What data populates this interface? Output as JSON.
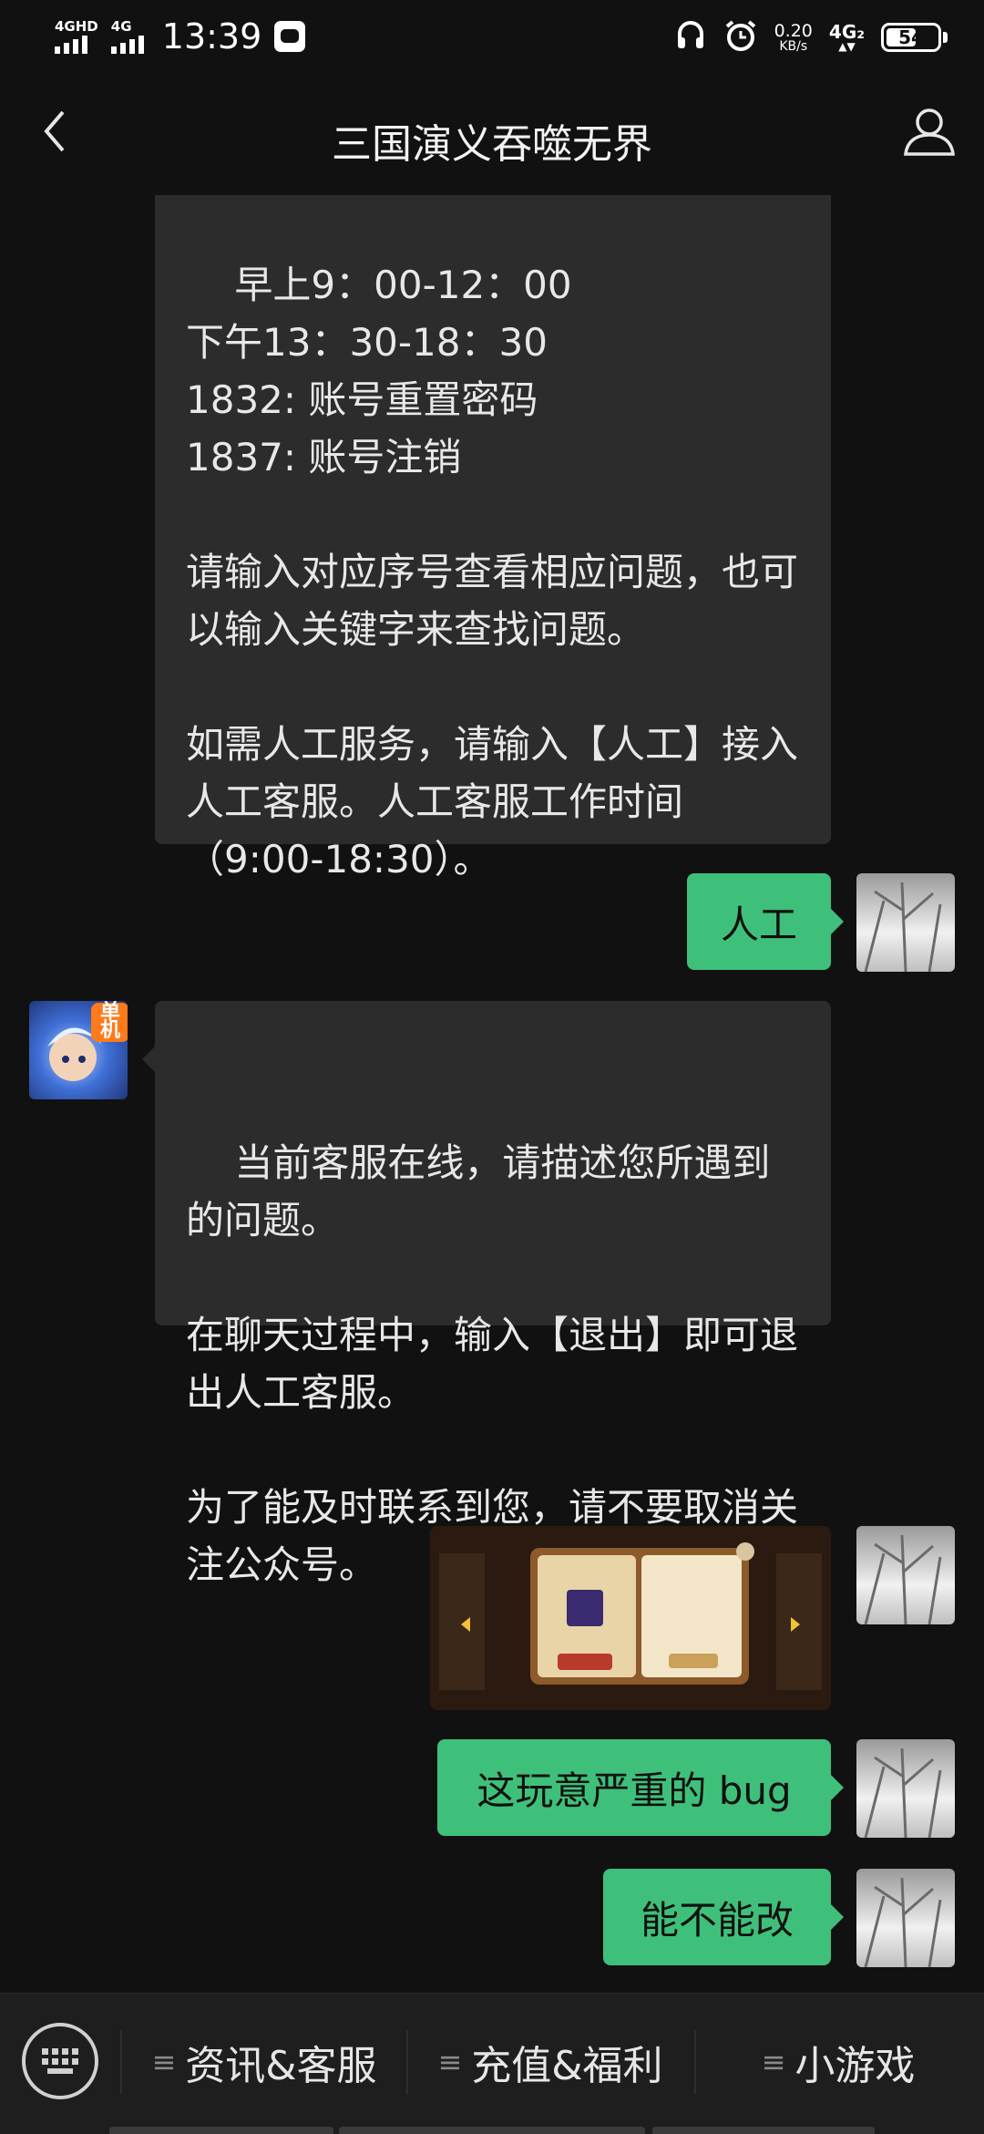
{
  "status_bar": {
    "network1": "4GHD",
    "network2": "4G",
    "time": "13:39",
    "speed_value": "0.20",
    "speed_unit": "KB/s",
    "network3": "4G₂",
    "battery": "54"
  },
  "header": {
    "title": "三国演义吞噬无界"
  },
  "messages": [
    {
      "from": "bot",
      "text": "早上9：00-12：00\n下午13：30-18：30\n1832: 账号重置密码\n1837: 账号注销\n\n请输入对应序号查看相应问题，也可以输入关键字来查找问题。\n\n如需人工服务，请输入【人工】接入人工客服。人工客服工作时间（9:00-18:30）。"
    },
    {
      "from": "user",
      "text": "人工"
    },
    {
      "from": "bot",
      "avatar_badge": "单机",
      "text": "当前客服在线，请描述您所遇到的问题。\n\n在聊天过程中，输入【退出】即可退出人工客服。\n\n为了能及时联系到您，请不要取消关注公众号。"
    },
    {
      "from": "user",
      "type": "image"
    },
    {
      "from": "user",
      "text": "这玩意严重的 bug"
    },
    {
      "from": "user",
      "text": "能不能改"
    }
  ],
  "bottom_menu": {
    "items": [
      {
        "label": "资讯&客服"
      },
      {
        "label": "充值&福利"
      },
      {
        "label": "小游戏"
      }
    ]
  },
  "colors": {
    "background": "#111111",
    "bubble_in": "#2c2c2c",
    "bubble_out": "#3fc07a",
    "menu_bar": "#1e1e1e"
  }
}
